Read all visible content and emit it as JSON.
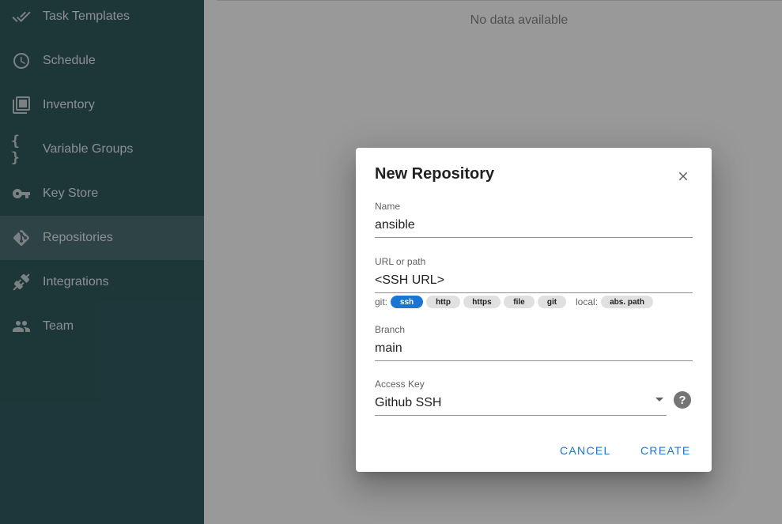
{
  "sidebar": {
    "items": [
      {
        "label": "Task Templates",
        "icon": "double-check-icon"
      },
      {
        "label": "Schedule",
        "icon": "clock-icon"
      },
      {
        "label": "Inventory",
        "icon": "monitor-icon"
      },
      {
        "label": "Variable Groups",
        "icon": "braces-icon",
        "glyph": "{ }"
      },
      {
        "label": "Key Store",
        "icon": "key-icon"
      },
      {
        "label": "Repositories",
        "icon": "git-icon",
        "active": true
      },
      {
        "label": "Integrations",
        "icon": "plug-icon"
      },
      {
        "label": "Team",
        "icon": "people-icon"
      }
    ]
  },
  "main": {
    "empty_text": "No data available"
  },
  "dialog": {
    "title": "New Repository",
    "name_field": {
      "label": "Name",
      "value": "ansible"
    },
    "url_field": {
      "label": "URL or path",
      "value": "<SSH URL>"
    },
    "url_types": {
      "git_label": "git:",
      "git_options": [
        "ssh",
        "http",
        "https",
        "file",
        "git"
      ],
      "selected": "ssh",
      "local_label": "local:",
      "local_options": [
        "abs. path"
      ]
    },
    "branch_field": {
      "label": "Branch",
      "value": "main"
    },
    "access_key_field": {
      "label": "Access Key",
      "value": "Github SSH"
    },
    "help_glyph": "?",
    "cancel_label": "CANCEL",
    "create_label": "CREATE"
  },
  "colors": {
    "sidebar_bg": "#1b4a4f",
    "sidebar_active_bg": "#3a6064",
    "accent": "#1976d2",
    "overlay": "rgba(33,33,33,0.46)"
  }
}
